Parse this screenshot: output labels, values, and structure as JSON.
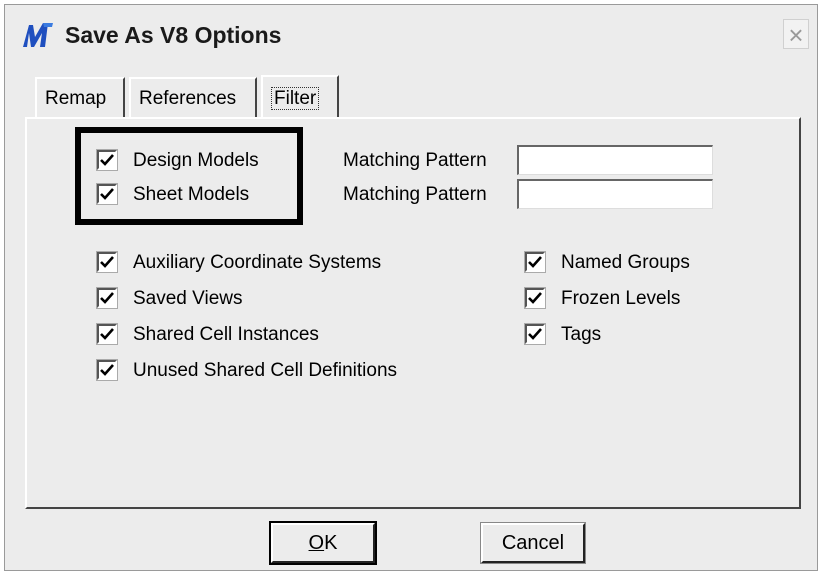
{
  "window": {
    "title": "Save As V8 Options",
    "close_glyph": "×",
    "icon": "microstation-m-icon"
  },
  "tabs": [
    {
      "label": "Remap"
    },
    {
      "label": "References"
    },
    {
      "label": "Filter",
      "selected": true
    }
  ],
  "filter": {
    "models": [
      {
        "label": "Design Models",
        "checked": true,
        "pattern_label": "Matching Pattern",
        "pattern_value": ""
      },
      {
        "label": "Sheet Models",
        "checked": true,
        "pattern_label": "Matching Pattern",
        "pattern_value": ""
      }
    ],
    "left_options": [
      {
        "label": "Auxiliary Coordinate Systems",
        "checked": true
      },
      {
        "label": "Saved Views",
        "checked": true
      },
      {
        "label": "Shared Cell Instances",
        "checked": true
      },
      {
        "label": "Unused Shared Cell Definitions",
        "checked": true
      }
    ],
    "right_options": [
      {
        "label": "Named Groups",
        "checked": true
      },
      {
        "label": "Frozen Levels",
        "checked": true
      },
      {
        "label": "Tags",
        "checked": true
      }
    ]
  },
  "buttons": {
    "ok_mnemonic": "O",
    "ok_rest": "K",
    "cancel": "Cancel"
  },
  "colors": {
    "dialog_bg": "#ececec",
    "icon_blue": "#1f4fbf"
  }
}
